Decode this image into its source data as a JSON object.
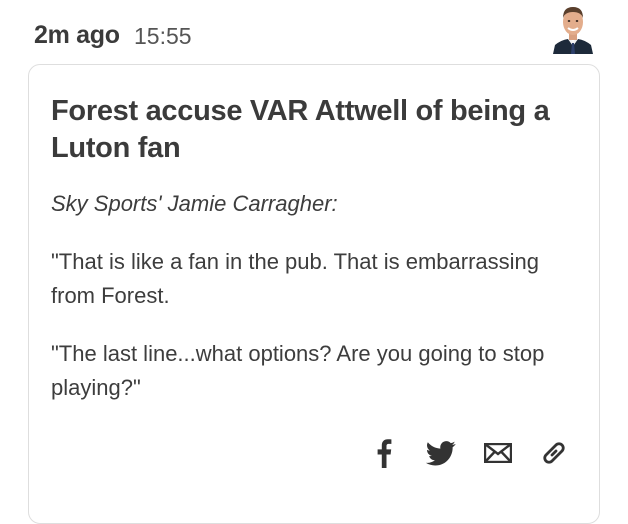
{
  "post": {
    "time_ago": "2m ago",
    "timestamp": "15:55",
    "headline": "Forest accuse VAR Attwell of being a Luton fan",
    "byline": "Sky Sports' Jamie Carragher:",
    "paragraphs": [
      "\"That is like a fan in the pub. That is embarrassing from Forest.",
      "\"The last line...what options? Are you going to stop playing?\""
    ]
  },
  "share": {
    "icons": [
      "facebook-icon",
      "twitter-icon",
      "email-icon",
      "link-icon"
    ]
  },
  "colors": {
    "text": "#3b3b3b",
    "border": "#dedede",
    "icon": "#333333"
  }
}
